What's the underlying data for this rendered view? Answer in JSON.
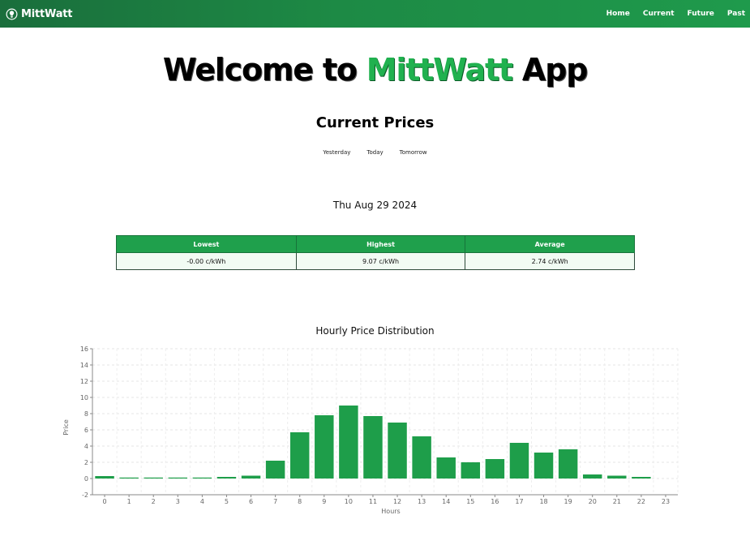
{
  "nav": {
    "brand": "MittWatt",
    "links": [
      "Home",
      "Current",
      "Future",
      "Past"
    ]
  },
  "hero": {
    "prefix": "Welcome to ",
    "brand": "MittWatt",
    "suffix": " App"
  },
  "current": {
    "title": "Current Prices",
    "tabs": [
      "Yesterday",
      "Today",
      "Tomorrow"
    ],
    "date": "Thu Aug 29 2024"
  },
  "stats": {
    "headers": [
      "Lowest",
      "Highest",
      "Average"
    ],
    "values": [
      "-0.00 c/kWh",
      "9.07 c/kWh",
      "2.74 c/kWh"
    ]
  },
  "colors": {
    "brand_green": "#20b14f",
    "bar_green": "#1e9e4a",
    "nav_dark": "#1a6e3c"
  },
  "chart_title": "Hourly Price Distribution",
  "chart_data": {
    "type": "bar",
    "categories": [
      "0",
      "1",
      "2",
      "3",
      "4",
      "5",
      "6",
      "7",
      "8",
      "9",
      "10",
      "11",
      "12",
      "13",
      "14",
      "15",
      "16",
      "17",
      "18",
      "19",
      "20",
      "21",
      "22",
      "23"
    ],
    "values": [
      0.3,
      0.1,
      0.05,
      0.05,
      0.05,
      0.2,
      0.35,
      2.2,
      5.7,
      7.8,
      9.0,
      7.7,
      6.9,
      5.2,
      2.6,
      2.0,
      2.4,
      4.4,
      3.2,
      3.6,
      0.5,
      0.35,
      0.2,
      null
    ],
    "xlabel": "Hours",
    "ylabel": "Price",
    "ylim": [
      -2,
      16
    ],
    "yticks": [
      -2,
      0,
      2,
      4,
      6,
      8,
      10,
      12,
      14,
      16
    ],
    "grid": true
  }
}
